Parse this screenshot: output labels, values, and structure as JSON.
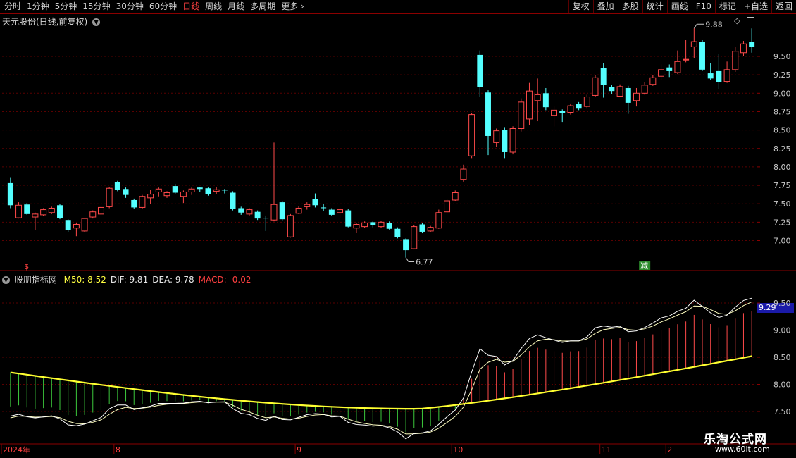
{
  "toolbar": {
    "periods": [
      "分时",
      "1分钟",
      "5分钟",
      "15分钟",
      "30分钟",
      "60分钟",
      "日线",
      "周线",
      "月线",
      "多周期",
      "更多"
    ],
    "active": "日线",
    "buttons": [
      "复权",
      "叠加",
      "多股",
      "统计",
      "画线",
      "F10",
      "标记",
      "+自选",
      "返回"
    ]
  },
  "main_panel": {
    "title": "天元股份(日线,前复权)",
    "high_label": "9.88",
    "low_label": "6.77",
    "marker_s": "$",
    "marker_jian": "减"
  },
  "indicator_panel": {
    "name": "股朋指标网",
    "values": [
      {
        "label": "M50: 8.52",
        "color": "#ffff40"
      },
      {
        "label": "DIF: 9.81",
        "color": "#e8e8e8"
      },
      {
        "label": "DEA: 9.78",
        "color": "#e8e8e8"
      },
      {
        "label": "MACD: -0.02",
        "color": "#ff4040"
      }
    ],
    "current_value": "9.29"
  },
  "price_axis": [
    "9.50",
    "9.25",
    "9.00",
    "8.75",
    "8.50",
    "8.25",
    "8.00",
    "7.75",
    "7.50",
    "7.25",
    "7.00"
  ],
  "indicator_axis": [
    "9.50",
    "9.00",
    "8.50",
    "8.00",
    "7.50"
  ],
  "date_axis": [
    {
      "label": "2024年",
      "i": 0
    },
    {
      "label": "8",
      "i": 13
    },
    {
      "label": "9",
      "i": 35
    },
    {
      "label": "10",
      "i": 54
    },
    {
      "label": "11",
      "i": 72
    },
    {
      "label": "2",
      "i": 80
    }
  ],
  "watermark": {
    "main": "乐淘公式网",
    "sub": "www.60lt.com"
  },
  "colors": {
    "up": "#ff4a4a",
    "down": "#54ffff",
    "m50": "#ffff30",
    "dif": "#ffffff",
    "dea": "#ffffc0",
    "grid": "#5a0000",
    "frame": "#8b0000"
  },
  "chart_data": {
    "type": "candlestick",
    "candles": [
      [
        7.78,
        7.48,
        7.86,
        7.44
      ],
      [
        7.31,
        7.48,
        7.52,
        7.3
      ],
      [
        7.49,
        7.36,
        7.51,
        7.35
      ],
      [
        7.32,
        7.36,
        7.38,
        7.14
      ],
      [
        7.35,
        7.42,
        7.44,
        7.33
      ],
      [
        7.38,
        7.44,
        7.46,
        7.36
      ],
      [
        7.48,
        7.31,
        7.5,
        7.29
      ],
      [
        7.28,
        7.14,
        7.29,
        7.12
      ],
      [
        7.17,
        7.22,
        7.24,
        7.06
      ],
      [
        7.13,
        7.3,
        7.31,
        7.12
      ],
      [
        7.32,
        7.39,
        7.41,
        7.3
      ],
      [
        7.36,
        7.45,
        7.47,
        7.35
      ],
      [
        7.46,
        7.71,
        7.73,
        7.44
      ],
      [
        7.79,
        7.69,
        7.81,
        7.67
      ],
      [
        7.7,
        7.62,
        7.72,
        7.58
      ],
      [
        7.55,
        7.45,
        7.57,
        7.43
      ],
      [
        7.45,
        7.6,
        7.62,
        7.43
      ],
      [
        7.58,
        7.63,
        7.69,
        7.5
      ],
      [
        7.66,
        7.7,
        7.72,
        7.6
      ],
      [
        7.61,
        7.65,
        7.67,
        7.58
      ],
      [
        7.74,
        7.65,
        7.77,
        7.63
      ],
      [
        7.6,
        7.66,
        7.68,
        7.51
      ],
      [
        7.66,
        7.7,
        7.72,
        7.62
      ],
      [
        7.72,
        7.7,
        7.73,
        7.66
      ],
      [
        7.71,
        7.63,
        7.72,
        7.61
      ],
      [
        7.67,
        7.69,
        7.73,
        7.63
      ],
      [
        7.69,
        7.68,
        7.7,
        7.64
      ],
      [
        7.65,
        7.43,
        7.67,
        7.41
      ],
      [
        7.44,
        7.38,
        7.46,
        7.35
      ],
      [
        7.36,
        7.42,
        7.44,
        7.34
      ],
      [
        7.39,
        7.3,
        7.41,
        7.28
      ],
      [
        7.31,
        7.3,
        7.34,
        7.13
      ],
      [
        7.28,
        7.49,
        8.33,
        7.26
      ],
      [
        7.52,
        7.29,
        7.54,
        7.27
      ],
      [
        7.05,
        7.34,
        7.36,
        7.04
      ],
      [
        7.37,
        7.44,
        7.47,
        7.36
      ],
      [
        7.46,
        7.49,
        7.52,
        7.42
      ],
      [
        7.56,
        7.48,
        7.64,
        7.45
      ],
      [
        7.45,
        7.44,
        7.5,
        7.4
      ],
      [
        7.42,
        7.35,
        7.44,
        7.33
      ],
      [
        7.38,
        7.42,
        7.45,
        7.3
      ],
      [
        7.41,
        7.19,
        7.43,
        7.18
      ],
      [
        7.17,
        7.22,
        7.24,
        7.11
      ],
      [
        7.19,
        7.24,
        7.26,
        7.17
      ],
      [
        7.25,
        7.21,
        7.26,
        7.18
      ],
      [
        7.19,
        7.25,
        7.27,
        7.17
      ],
      [
        7.24,
        7.16,
        7.26,
        7.15
      ],
      [
        7.16,
        7.05,
        7.18,
        7.03
      ],
      [
        7.02,
        6.87,
        7.03,
        6.77
      ],
      [
        6.89,
        7.19,
        7.21,
        6.88
      ],
      [
        7.22,
        7.12,
        7.24,
        7.1
      ],
      [
        7.13,
        7.18,
        7.2,
        7.12
      ],
      [
        7.17,
        7.38,
        7.42,
        7.16
      ],
      [
        7.39,
        7.54,
        7.56,
        7.38
      ],
      [
        7.55,
        7.65,
        7.68,
        7.54
      ],
      [
        7.83,
        7.97,
        8.03,
        7.8
      ],
      [
        8.15,
        8.71,
        8.73,
        8.12
      ],
      [
        9.52,
        9.08,
        9.58,
        8.95
      ],
      [
        9.01,
        8.42,
        9.04,
        8.16
      ],
      [
        8.33,
        8.49,
        8.52,
        8.27
      ],
      [
        8.5,
        8.2,
        8.54,
        8.12
      ],
      [
        8.2,
        8.52,
        8.55,
        8.17
      ],
      [
        8.52,
        8.88,
        8.93,
        8.48
      ],
      [
        8.65,
        9.03,
        9.14,
        8.57
      ],
      [
        8.9,
        8.98,
        9.2,
        8.62
      ],
      [
        9.0,
        8.81,
        9.07,
        8.77
      ],
      [
        8.7,
        8.77,
        8.82,
        8.55
      ],
      [
        8.76,
        8.73,
        8.78,
        8.61
      ],
      [
        8.74,
        8.83,
        8.86,
        8.71
      ],
      [
        8.85,
        8.8,
        8.88,
        8.77
      ],
      [
        8.82,
        8.95,
        8.98,
        8.8
      ],
      [
        8.97,
        9.21,
        9.25,
        8.95
      ],
      [
        9.34,
        9.11,
        9.41,
        8.94
      ],
      [
        9.08,
        9.03,
        9.11,
        8.99
      ],
      [
        8.96,
        9.09,
        9.12,
        8.95
      ],
      [
        9.07,
        8.87,
        9.1,
        8.72
      ],
      [
        8.9,
        9.0,
        9.07,
        8.82
      ],
      [
        9.0,
        9.11,
        9.15,
        8.98
      ],
      [
        9.12,
        9.21,
        9.25,
        9.1
      ],
      [
        9.23,
        9.32,
        9.39,
        9.18
      ],
      [
        9.35,
        9.3,
        9.39,
        9.22
      ],
      [
        9.28,
        9.43,
        9.58,
        9.26
      ],
      [
        9.45,
        9.46,
        9.72,
        9.42
      ],
      [
        9.63,
        9.7,
        9.88,
        9.48
      ],
      [
        9.7,
        9.32,
        9.72,
        9.3
      ],
      [
        9.27,
        9.2,
        9.41,
        9.18
      ],
      [
        9.3,
        9.15,
        9.53,
        9.05
      ],
      [
        9.16,
        9.32,
        9.43,
        9.14
      ],
      [
        9.32,
        9.57,
        9.63,
        9.29
      ],
      [
        9.55,
        9.67,
        9.71,
        9.5
      ],
      [
        9.7,
        9.63,
        9.88,
        9.55
      ]
    ],
    "indicator": {
      "m50_start": 8.22,
      "m50_mid": 7.55,
      "m50_end": 8.52,
      "dif_end": 9.81,
      "dea_end": 9.78,
      "macd_end": -0.02
    }
  }
}
